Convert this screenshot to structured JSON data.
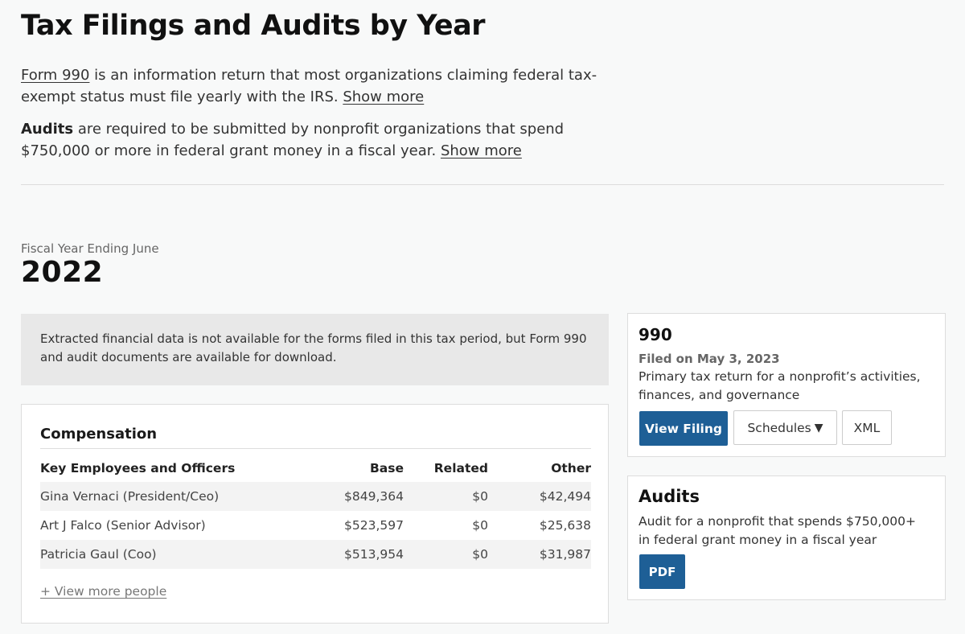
{
  "header": {
    "title": "Tax Filings and Audits by Year"
  },
  "intro": {
    "form990_link": "Form 990",
    "form990_text": " is an information return that most organizations claiming federal tax-exempt status must file yearly with the IRS. ",
    "audits_label": "Audits",
    "audits_text": " are required to be submitted by nonprofit organizations that spend $750,000 or more in federal grant money in a fiscal year. ",
    "show_more": "Show more"
  },
  "fiscal_year": {
    "label": "Fiscal Year Ending June",
    "year": "2022"
  },
  "notice": "Extracted financial data is not available for the forms filed in this tax period, but Form 990 and audit documents are available for download.",
  "compensation": {
    "title": "Compensation",
    "headers": [
      "Key Employees and Officers",
      "Base",
      "Related",
      "Other"
    ],
    "rows": [
      [
        "Gina Vernaci (President/Ceo)",
        "$849,364",
        "$0",
        "$42,494"
      ],
      [
        "Art J Falco (Senior Advisor)",
        "$523,597",
        "$0",
        "$25,638"
      ],
      [
        "Patricia Gaul (Coo)",
        "$513,954",
        "$0",
        "$31,987"
      ]
    ],
    "view_more": "+ View more people"
  },
  "filing_card": {
    "title": "990",
    "filed": "Filed on May 3, 2023",
    "description": "Primary tax return for a nonprofit’s activities, finances, and governance",
    "view_filing": "View Filing",
    "schedules": "Schedules",
    "xml": "XML"
  },
  "audits_card": {
    "title": "Audits",
    "description": "Audit for a nonprofit that spends $750,000+ in federal grant money in a fiscal year",
    "pdf": "PDF"
  },
  "icons": {
    "schedules_caret": "caret-down-icon"
  },
  "colors": {
    "primary_button": "#1e5f96",
    "background": "#f8f9f9"
  }
}
